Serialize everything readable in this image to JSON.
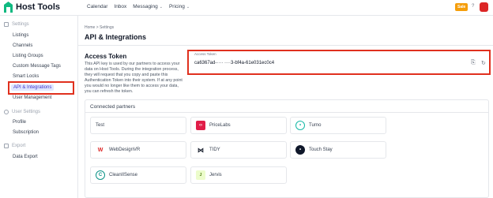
{
  "app": {
    "name": "Host Tools"
  },
  "topnav": {
    "items": [
      "Calendar",
      "Inbox",
      "Messaging",
      "Pricing"
    ]
  },
  "header": {
    "sale_badge": "Sale",
    "help": "?"
  },
  "sidebar": {
    "settings_heading": "Settings",
    "settings_items": [
      "Listings",
      "Channels",
      "Listing Groups",
      "Custom Message Tags",
      "Smart Locks",
      "API & Integrations",
      "User Management"
    ],
    "user_heading": "User Settings",
    "user_items": [
      "Profile",
      "Subscription"
    ],
    "export_heading": "Export",
    "export_items": [
      "Data Export"
    ]
  },
  "main": {
    "breadcrumb": "Home  >  Settings",
    "title": "API & Integrations",
    "access_token": {
      "title": "Access Token",
      "description": "This API key is used by our partners to access your data on Host Tools. During the integration process, they will request that you copy and paste this Authentication Token into their system. If at any point you would no longer like them to access your data, you can refresh the token.",
      "label": "Access Token",
      "value": "ca6367ad-····  ····3-bf4a-61e031ec0c4"
    },
    "partners": {
      "heading": "Connected partners",
      "items": [
        {
          "name": "Test",
          "icon": "none",
          "color": ""
        },
        {
          "name": "PriceLabs",
          "icon": "pricelabs-logo",
          "color": "#e11d48"
        },
        {
          "name": "Turno",
          "icon": "turno-logo",
          "color": "#14b8a6"
        },
        {
          "name": "WebDesignVR",
          "icon": "webdesignvr-logo",
          "color": "#dc2626"
        },
        {
          "name": "TIDY",
          "icon": "tidy-logo",
          "color": "#111827"
        },
        {
          "name": "Touch Stay",
          "icon": "touchstay-logo",
          "color": "#0f172a"
        },
        {
          "name": "CleanIISense",
          "icon": "cleanlisense-logo",
          "color": "#0d9488"
        },
        {
          "name": "Jervis",
          "icon": "jervis-logo",
          "color": "#4d7c0f"
        }
      ]
    }
  }
}
